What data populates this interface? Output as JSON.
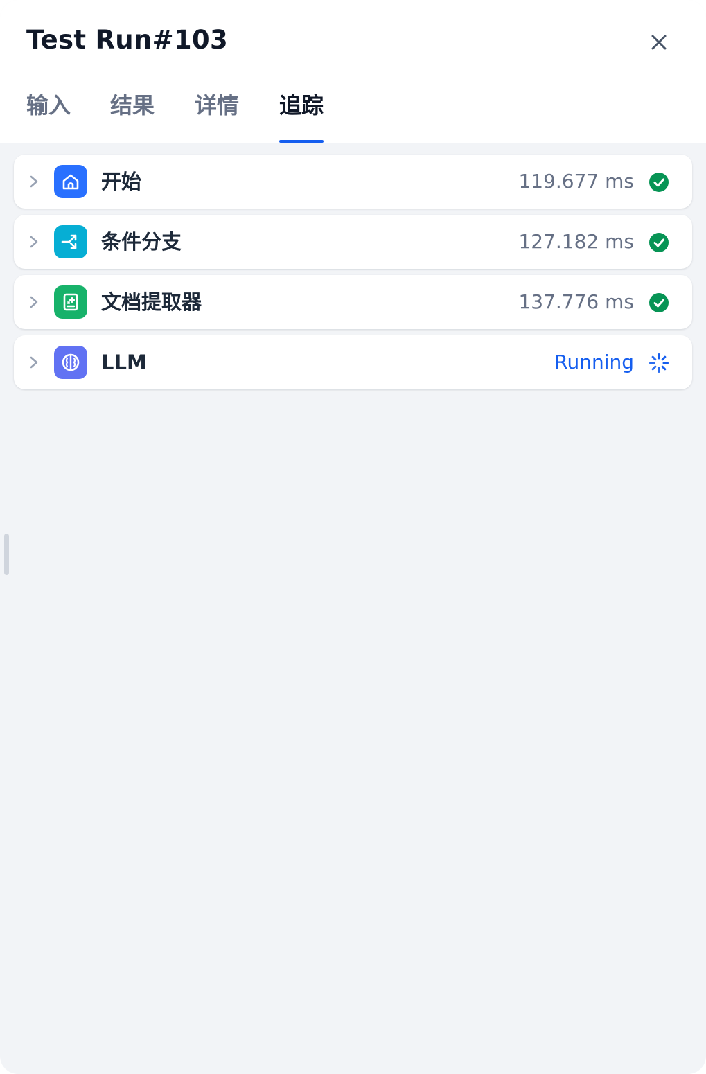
{
  "panel": {
    "title": "Test Run#103",
    "close_icon": "close-icon"
  },
  "tabs": [
    {
      "label": "输入",
      "active": false
    },
    {
      "label": "结果",
      "active": false
    },
    {
      "label": "详情",
      "active": false
    },
    {
      "label": "追踪",
      "active": true
    }
  ],
  "trace": {
    "nodes": [
      {
        "name": "开始",
        "time": "119.677 ms",
        "status": "succeeded",
        "icon": "home-icon",
        "icon_color": "#2970ff"
      },
      {
        "name": "条件分支",
        "time": "127.182 ms",
        "status": "succeeded",
        "icon": "branch-icon",
        "icon_color": "#06aed4"
      },
      {
        "name": "文档提取器",
        "time": "137.776 ms",
        "status": "succeeded",
        "icon": "document-extract-icon",
        "icon_color": "#17b26a"
      },
      {
        "name": "LLM",
        "time": "Running",
        "status": "running",
        "icon": "llm-brain-icon",
        "icon_color": "#6172f3"
      }
    ]
  },
  "colors": {
    "accent": "#155eef",
    "success": "#079455",
    "background": "#f2f4f7"
  }
}
